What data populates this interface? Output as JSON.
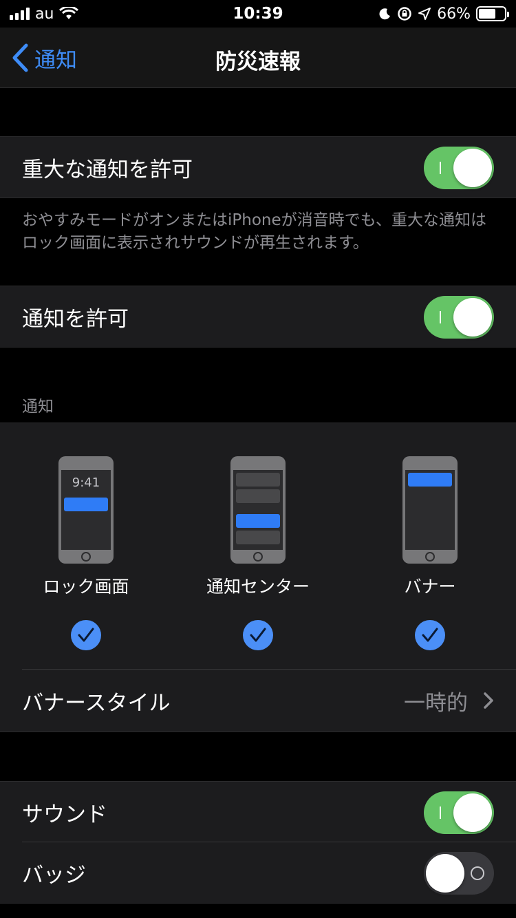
{
  "status": {
    "carrier": "au",
    "time": "10:39",
    "battery": "66%"
  },
  "nav": {
    "back_label": "通知",
    "title": "防災速報"
  },
  "critical": {
    "label": "重大な通知を許可",
    "enabled": true,
    "footer": "おやすみモードがオンまたはiPhoneが消音時でも、重大な通知はロック画面に表示されサウンドが再生されます。"
  },
  "allow": {
    "label": "通知を許可",
    "enabled": true
  },
  "alerts": {
    "header": "通知",
    "preview_time": "9:41",
    "styles": [
      {
        "label": "ロック画面",
        "checked": true
      },
      {
        "label": "通知センター",
        "checked": true
      },
      {
        "label": "バナー",
        "checked": true
      }
    ],
    "banner_style": {
      "label": "バナースタイル",
      "value": "一時的"
    }
  },
  "sound": {
    "label": "サウンド",
    "enabled": true
  },
  "badge": {
    "label": "バッジ",
    "enabled": false
  },
  "colors": {
    "accent": "#3e8cf7",
    "toggle_on": "#65c466",
    "check": "#4b8ff7"
  }
}
